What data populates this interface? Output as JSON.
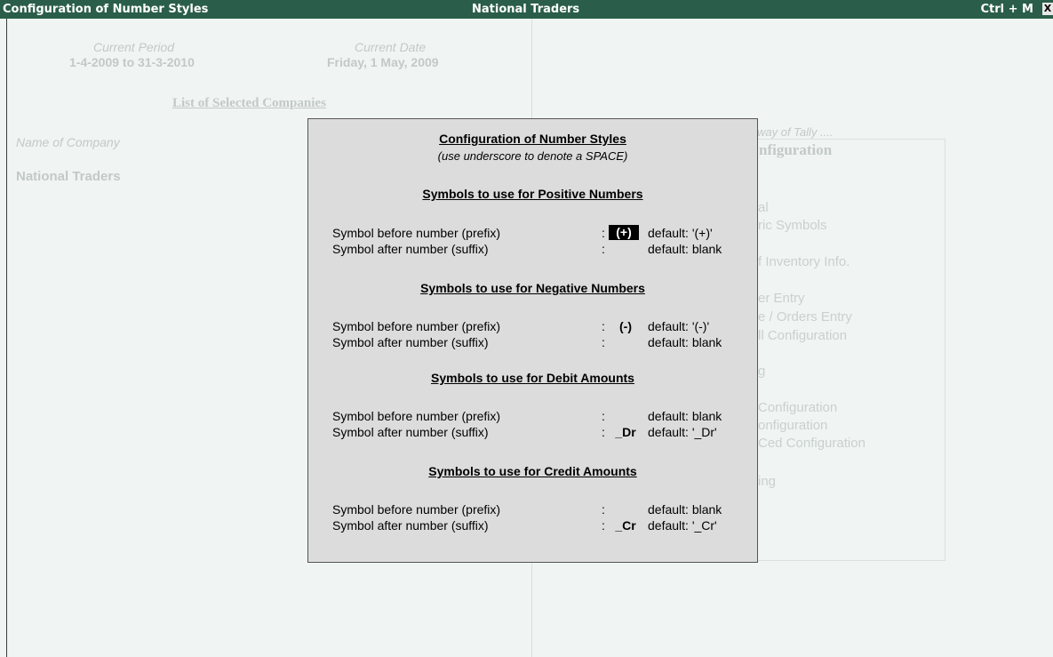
{
  "titlebar": {
    "left": "Configuration of Number Styles",
    "center": "National Traders",
    "right": "Ctrl + M",
    "close": "X"
  },
  "background": {
    "current_period_label": "Current Period",
    "current_period_value": "1-4-2009 to 31-3-2010",
    "current_date_label": "Current Date",
    "current_date_value": "Friday, 1 May, 2009",
    "list_heading": "List of Selected Companies",
    "name_of_company_label": "Name of Company",
    "company_name": "National Traders",
    "gateway_title": "way of Tally ....",
    "config_heading": "nfiguration",
    "menu_fragments": [
      "al",
      "ric Symbols",
      "f Inventory Info.",
      "er Entry",
      "e / Orders Entry",
      "ll Configuration",
      "g",
      "Configuration",
      "onfiguration",
      "Ced Configuration",
      "ing"
    ]
  },
  "dialog": {
    "title": "Configuration of Number Styles",
    "subtitle": "(use underscore to denote a SPACE)",
    "sections": [
      {
        "heading": "Symbols to use for Positive Numbers",
        "rows": [
          {
            "label": "Symbol before number (prefix)",
            "colon": ":",
            "value": "(+)",
            "default": "default: '(+)'",
            "selected": true
          },
          {
            "label": "Symbol after number (suffix)",
            "colon": ":",
            "value": "",
            "default": "default: blank",
            "selected": false
          }
        ]
      },
      {
        "heading": "Symbols to use for Negative Numbers",
        "rows": [
          {
            "label": "Symbol before number (prefix)",
            "colon": ":",
            "value": "(-)",
            "default": "default: '(-)'",
            "selected": false
          },
          {
            "label": "Symbol after number (suffix)",
            "colon": ":",
            "value": "",
            "default": "default: blank",
            "selected": false
          }
        ]
      },
      {
        "heading": "Symbols to use for Debit Amounts",
        "rows": [
          {
            "label": "Symbol before number (prefix)",
            "colon": ":",
            "value": "",
            "default": "default: blank",
            "selected": false
          },
          {
            "label": "Symbol after number (suffix)",
            "colon": ":",
            "value": "_Dr",
            "default": "default: '_Dr'",
            "selected": false
          }
        ]
      },
      {
        "heading": "Symbols to use for Credit Amounts",
        "rows": [
          {
            "label": "Symbol before number (prefix)",
            "colon": ":",
            "value": "",
            "default": "default: blank",
            "selected": false
          },
          {
            "label": "Symbol after number (suffix)",
            "colon": ":",
            "value": "_Cr",
            "default": "default: '_Cr'",
            "selected": false
          }
        ]
      }
    ]
  },
  "colors": {
    "titlebar_bg": "#2a5e4a",
    "page_bg": "#f0f5f3",
    "dialog_bg": "#dcdcdc",
    "faded_text": "#c2c9c6"
  }
}
